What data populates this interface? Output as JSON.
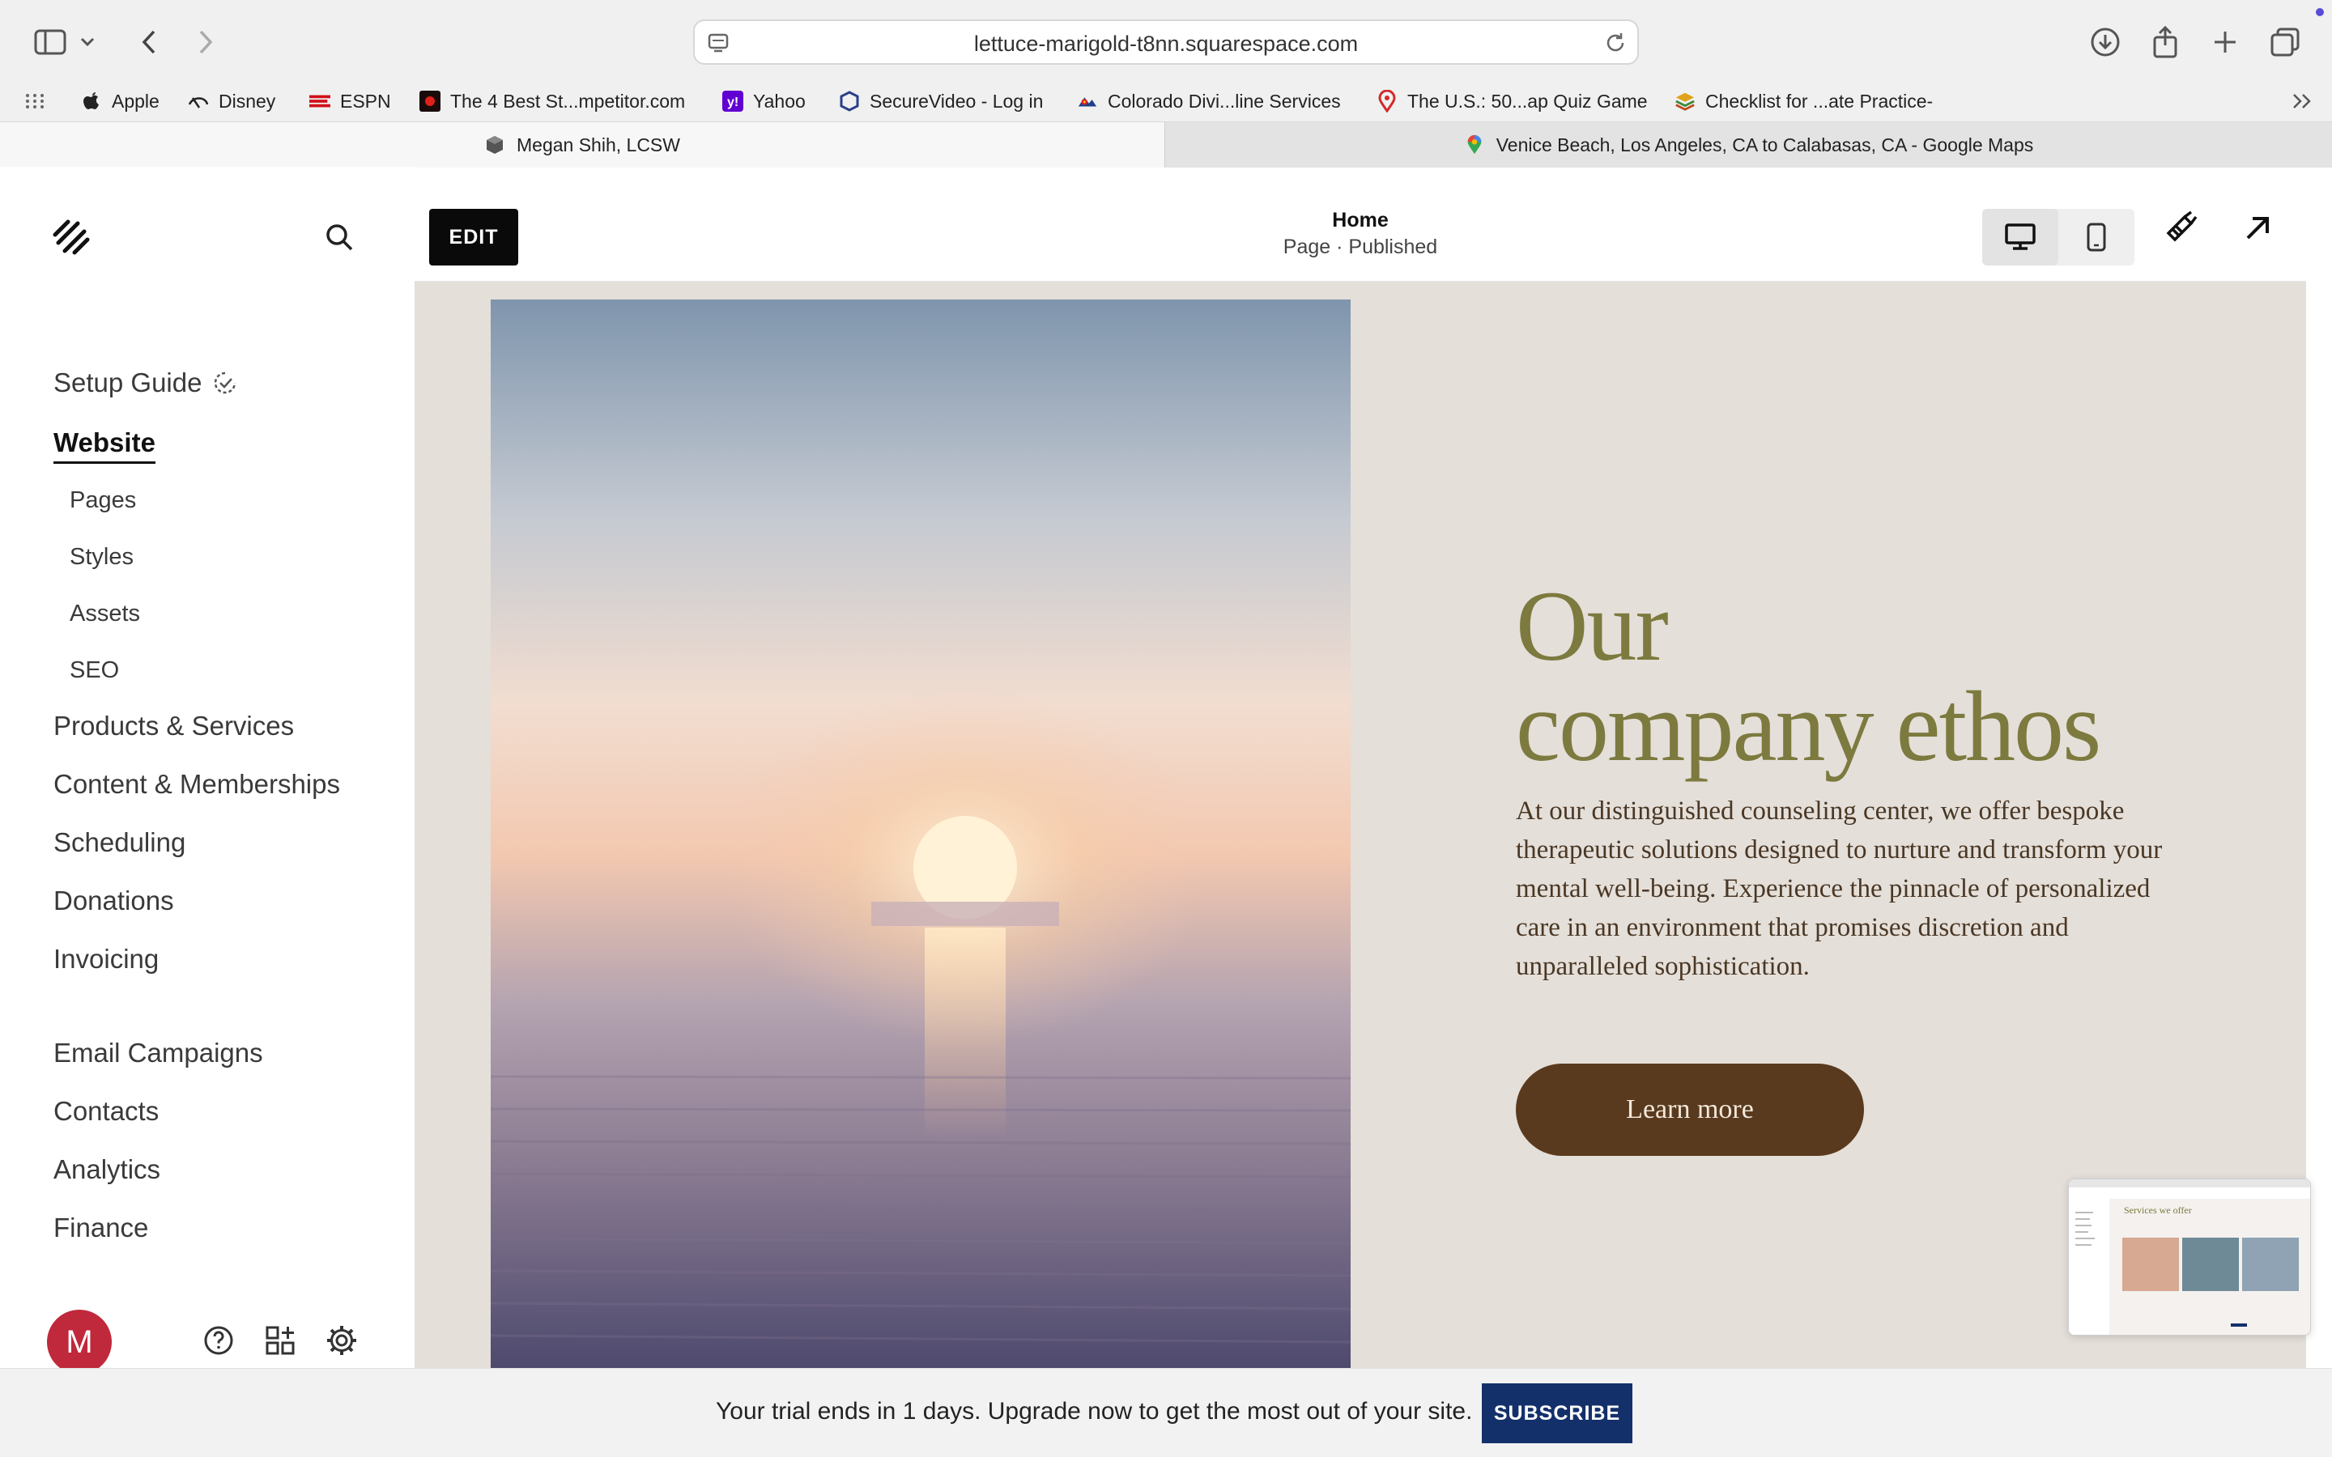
{
  "browser": {
    "url": "lettuce-marigold-t8nn.squarespace.com",
    "bookmarks": [
      {
        "label": "Apple",
        "icon": "apple-icon"
      },
      {
        "label": "Disney",
        "icon": "disney-icon"
      },
      {
        "label": "ESPN",
        "icon": "espn-icon"
      },
      {
        "label": "The 4 Best St...mpetitor.com",
        "icon": "site-icon"
      },
      {
        "label": "Yahoo",
        "icon": "yahoo-icon"
      },
      {
        "label": "SecureVideo - Log in",
        "icon": "securevideo-icon"
      },
      {
        "label": "Colorado Divi...line Services",
        "icon": "colorado-icon"
      },
      {
        "label": "The U.S.: 50...ap Quiz Game",
        "icon": "map-pin-icon"
      },
      {
        "label": "Checklist for ...ate Practice-",
        "icon": "checklist-icon"
      }
    ],
    "tabs": [
      {
        "label": "Megan Shih, LCSW",
        "active": true
      },
      {
        "label": "Venice Beach, Los Angeles, CA to Calabasas, CA - Google Maps",
        "active": false
      }
    ]
  },
  "sidebar": {
    "setup_guide": "Setup Guide",
    "website": "Website",
    "website_sub": [
      "Pages",
      "Styles",
      "Assets",
      "SEO"
    ],
    "sections": [
      "Products & Services",
      "Content & Memberships",
      "Scheduling",
      "Donations",
      "Invoicing"
    ],
    "sections2": [
      "Email Campaigns",
      "Contacts",
      "Analytics",
      "Finance"
    ],
    "avatar_letter": "M"
  },
  "editor": {
    "edit_label": "EDIT",
    "page_title": "Home",
    "page_status": "Page · Published"
  },
  "hero": {
    "heading_line1": "Our",
    "heading_line2": "company ethos",
    "body": "At our distinguished counseling center, we offer bespoke therapeutic solutions designed to nurture and transform your mental well-being. Experience the pinnacle of personalized care in an environment that promises discretion and unparalleled sophistication.",
    "button": "Learn more",
    "thumbnail_caption": "Services we offer"
  },
  "trial_banner": {
    "text": "Your trial ends in 1 days. Upgrade now to get the most out of your site.",
    "button": "SUBSCRIBE"
  },
  "colors": {
    "heading": "#7c7a3e",
    "body_text": "#4a3724",
    "button_bg": "#5a3a1e",
    "page_bg": "#e4dfd9",
    "subscribe_bg": "#14306b",
    "avatar_bg": "#c0283c"
  }
}
